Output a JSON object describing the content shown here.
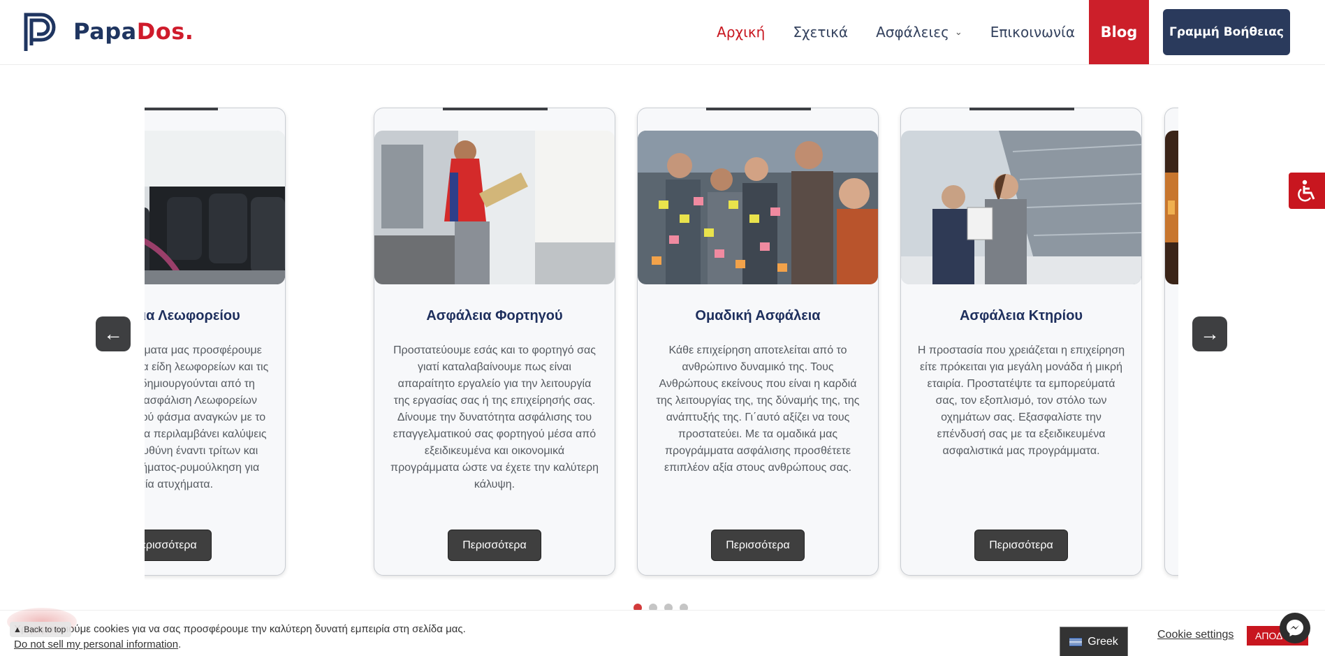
{
  "header": {
    "logo_part1": "Papa",
    "logo_part2": "Dos."
  },
  "nav": {
    "home": "Αρχική",
    "about": "Σχετικά",
    "insurance": "Ασφάλειες",
    "contact": "Επικοινωνία",
    "blog": "Blog",
    "helpline": "Γραμμή Βοήθειας"
  },
  "cards": [
    {
      "title": "Ασφάλεια Λεωφορείου",
      "text": "Με τα προγράμματα μας προσφέρουμε κάλυψη σε όλα τα είδη λεωφορείων και τις ανάγκες που δημιουργούνται από τη χρήση τους Η ασφάλιση Λεωφορείων καλύπτει ένα ευρύ φάσμα αναγκών με το βασικό πακέτο να περιλαμβάνει καλύψεις όπως αστική ευθύνη έναντι τρίτων και φροντίδα ατυχήματος-ρυμούλκηση για τροχαία ατυχήματα.",
      "button": "Περισσότερα"
    },
    {
      "title": "Ασφάλεια Φορτηγού",
      "text": "Προστατεύουμε εσάς και το φορτηγό σας γιατί καταλαβαίνουμε πως είναι απαραίτητο εργαλείο για την λειτουργία της εργασίας σας ή της επιχείρησής σας. Δίνουμε την δυνατότητα ασφάλισης του επαγγελματικού σας φορτηγού μέσα από εξειδικευμένα και οικονομικά προγράμματα ώστε να έχετε την καλύτερη κάλυψη.",
      "button": "Περισσότερα"
    },
    {
      "title": "Ομαδική Ασφάλεια",
      "text": "Κάθε επιχείρηση αποτελείται από το ανθρώπινο δυναμικό της. Τους Ανθρώπους εκείνους που είναι η καρδιά της λειτουργίας της, της δύναμής της, της ανάπτυξής της. Γι΄αυτό αξίζει να τους προστατεύει. Με τα ομαδικά μας προγράμματα ασφάλισης προσθέτετε επιπλέον αξία στους ανθρώπους σας.",
      "button": "Περισσότερα"
    },
    {
      "title": "Ασφάλεια Κτηρίου",
      "text": "Η προστασία που χρειάζεται η επιχείρηση είτε πρόκειται για μεγάλη μονάδα ή μικρή εταιρία. Προστατέψτε τα εμπορεύματά σας, τον εξοπλισμό, τον στόλο των οχημάτων σας. Εξασφαλίστε την επένδυσή σας με τα εξειδικευμένα ασφαλιστικά μας προγράμματα.",
      "button": "Περισσότερα"
    }
  ],
  "carousel": {
    "prev": "←",
    "next": "→",
    "active_slide": 1,
    "slide_count": 4
  },
  "cookie": {
    "text": "Χρησιμοποιούμε cookies για να σας προσφέρουμε την καλύτερη δυνατή εμπειρία στη σελίδα μας.",
    "dnsmpi": "Do not sell my personal information",
    "dnsmpi_suffix": ".",
    "settings": "Cookie settings",
    "accept": "ΑΠΟΔΟΧΗ"
  },
  "back_to_top": "▲ Back to top",
  "language": "Greek",
  "colors": {
    "brand_navy": "#1f3560",
    "brand_red": "#cc1f2a"
  }
}
